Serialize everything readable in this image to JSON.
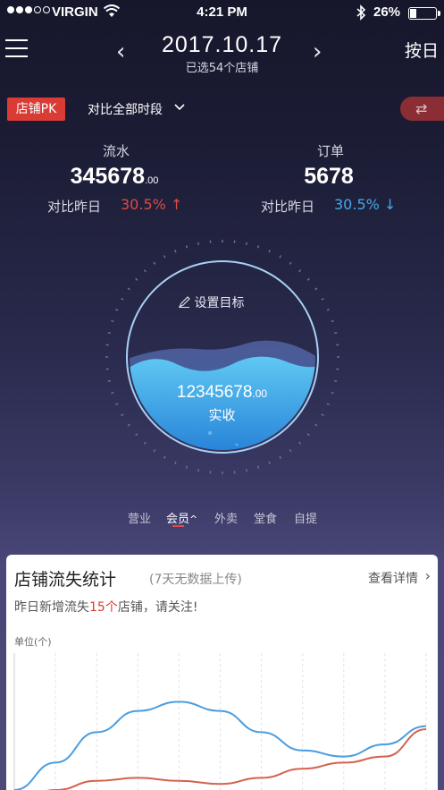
{
  "status_bar": {
    "carrier": "VIRGIN",
    "time": "4:21 PM",
    "battery_pct": "26%",
    "battery_level": 0.26
  },
  "header": {
    "date": "2017.10.17",
    "subtitle": "已选54个店铺",
    "right_label": "按日",
    "menu_icon": "hamburger-menu-icon",
    "prev_icon": "chevron-left-icon",
    "next_icon": "chevron-right-icon"
  },
  "toolbar": {
    "pk_label": "店铺PK",
    "compare_label": "对比全部时段",
    "swap_icon": "swap-arrows-icon"
  },
  "stats": {
    "flow": {
      "label": "流水",
      "value": "345678",
      "decimal": ".00",
      "compare_label": "对比昨日",
      "pct": "30.5%",
      "trend": "up",
      "color": "#e04a44"
    },
    "orders": {
      "label": "订单",
      "value": "5678",
      "compare_label": "对比昨日",
      "pct": "30.5%",
      "trend": "down",
      "color": "#46a8ea"
    }
  },
  "gauge": {
    "goal_label": "设置目标",
    "actual_value": "12345678",
    "actual_decimal": ".00",
    "actual_label": "实收",
    "edit_icon": "pencil-icon"
  },
  "categories": {
    "items": [
      "营业",
      "会员",
      "外卖",
      "堂食",
      "自提"
    ],
    "active_index": 1
  },
  "loss_card": {
    "title": "店铺流失统计",
    "note": "(7天无数据上传)",
    "link": "查看详情",
    "alert_prefix": "昨日新增流失",
    "alert_count": "15个",
    "alert_suffix": "店铺，请关注!",
    "unit_label": "单位(个)"
  },
  "chart_data": {
    "type": "line",
    "title": "",
    "xlabel": "",
    "ylabel": "单位(个)",
    "grid": true,
    "series": [
      {
        "color": "#4a9de0",
        "values": [
          10,
          28,
          48,
          62,
          68,
          62,
          48,
          36,
          32,
          40,
          52
        ]
      },
      {
        "color": "#d4624f",
        "values": [
          2,
          10,
          16,
          18,
          16,
          14,
          18,
          24,
          28,
          32,
          50
        ]
      }
    ],
    "ylim": [
      0,
      100
    ]
  }
}
